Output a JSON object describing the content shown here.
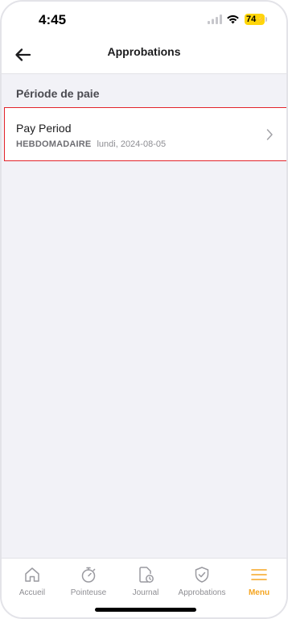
{
  "status_bar": {
    "time": "4:45",
    "battery": "74"
  },
  "header": {
    "title": "Approbations"
  },
  "section": {
    "title": "Période de paie",
    "items": [
      {
        "title": "Pay Period",
        "badge": "HEBDOMADAIRE",
        "date": "lundi, 2024-08-05"
      }
    ]
  },
  "tab_bar": {
    "active": "Menu",
    "tabs": [
      {
        "label": "Accueil",
        "icon": "home-icon"
      },
      {
        "label": "Pointeuse",
        "icon": "stopwatch-icon"
      },
      {
        "label": "Journal",
        "icon": "journal-clock-icon"
      },
      {
        "label": "Approbations",
        "icon": "shield-check-icon"
      },
      {
        "label": "Menu",
        "icon": "hamburger-menu-icon"
      }
    ]
  },
  "colors": {
    "accent": "#f5a623",
    "highlight_border": "#e3242b",
    "background": "#f2f2f7",
    "battery": "#ffd60a"
  }
}
